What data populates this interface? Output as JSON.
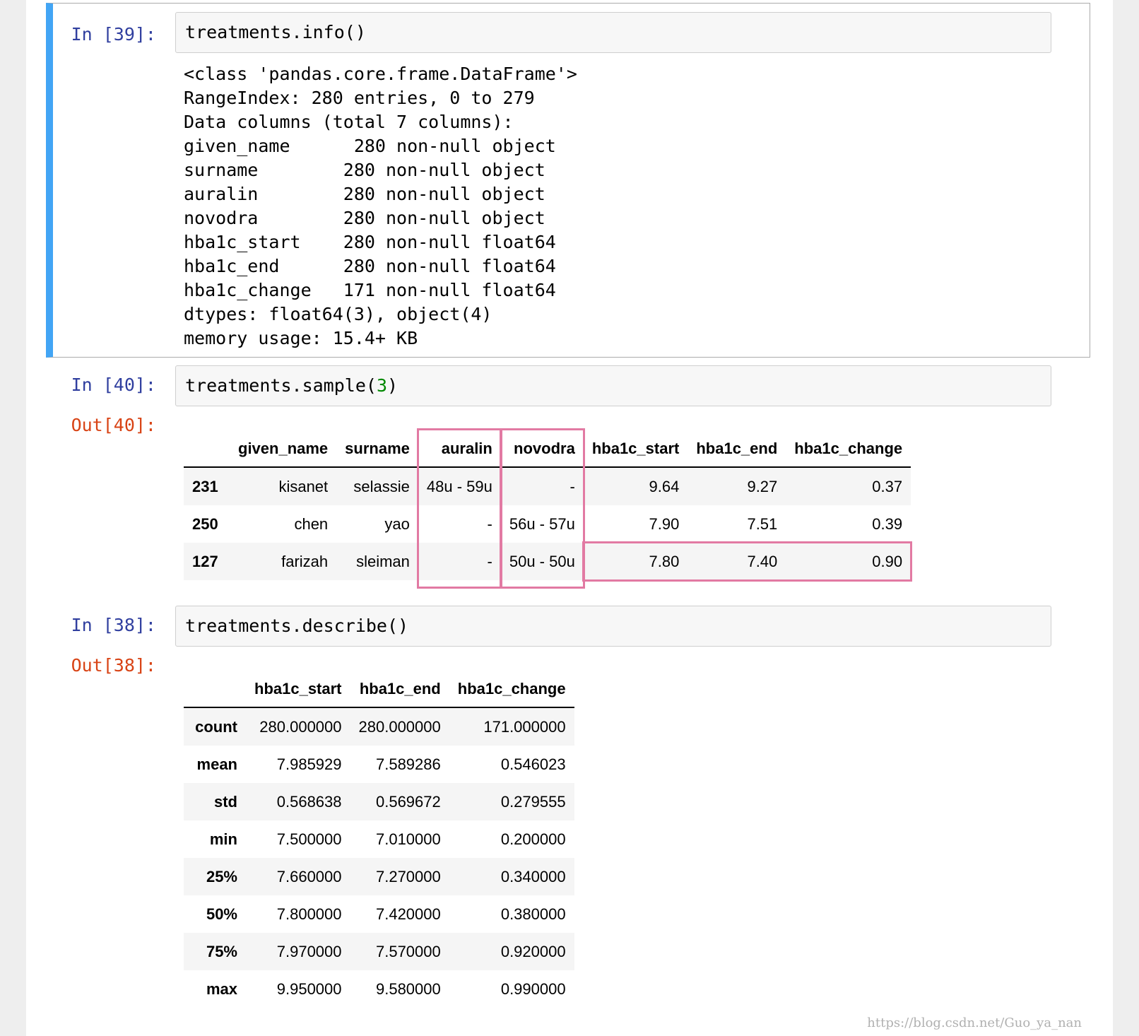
{
  "cells": {
    "info": {
      "prompt": "In [39]:",
      "code": "treatments.info()",
      "output_lines": [
        "<class 'pandas.core.frame.DataFrame'>",
        "RangeIndex: 280 entries, 0 to 279",
        "Data columns (total 7 columns):",
        "given_name      280 non-null object",
        "surname        280 non-null object",
        "auralin        280 non-null object",
        "novodra        280 non-null object",
        "hba1c_start    280 non-null float64",
        "hba1c_end      280 non-null float64",
        "hba1c_change   171 non-null float64",
        "dtypes: float64(3), object(4)",
        "memory usage: 15.4+ KB"
      ]
    },
    "sample": {
      "prompt": "In [40]:",
      "code_func": "treatments.sample",
      "code_open": "(",
      "code_arg": "3",
      "code_close": ")",
      "out_prompt": "Out[40]:",
      "columns": [
        "",
        "given_name",
        "surname",
        "auralin",
        "novodra",
        "hba1c_start",
        "hba1c_end",
        "hba1c_change"
      ],
      "rows": [
        {
          "index": "231",
          "cells": [
            "kisanet",
            "selassie",
            "48u - 59u",
            "-",
            "9.64",
            "9.27",
            "0.37"
          ]
        },
        {
          "index": "250",
          "cells": [
            "chen",
            "yao",
            "-",
            "56u - 57u",
            "7.90",
            "7.51",
            "0.39"
          ]
        },
        {
          "index": "127",
          "cells": [
            "farizah",
            "sleiman",
            "-",
            "50u - 50u",
            "7.80",
            "7.40",
            "0.90"
          ]
        }
      ],
      "highlight_color": "#e27aa3"
    },
    "describe": {
      "prompt": "In [38]:",
      "code": "treatments.describe()",
      "out_prompt": "Out[38]:",
      "columns": [
        "",
        "hba1c_start",
        "hba1c_end",
        "hba1c_change"
      ],
      "rows": [
        {
          "index": "count",
          "cells": [
            "280.000000",
            "280.000000",
            "171.000000"
          ]
        },
        {
          "index": "mean",
          "cells": [
            "7.985929",
            "7.589286",
            "0.546023"
          ]
        },
        {
          "index": "std",
          "cells": [
            "0.568638",
            "0.569672",
            "0.279555"
          ]
        },
        {
          "index": "min",
          "cells": [
            "7.500000",
            "7.010000",
            "0.200000"
          ]
        },
        {
          "index": "25%",
          "cells": [
            "7.660000",
            "7.270000",
            "0.340000"
          ]
        },
        {
          "index": "50%",
          "cells": [
            "7.800000",
            "7.420000",
            "0.380000"
          ]
        },
        {
          "index": "75%",
          "cells": [
            "7.970000",
            "7.570000",
            "0.920000"
          ]
        },
        {
          "index": "max",
          "cells": [
            "9.950000",
            "9.580000",
            "0.990000"
          ]
        }
      ]
    }
  },
  "watermark": "https://blog.csdn.net/Guo_ya_nan",
  "colors": {
    "selected_bar": "#42a5f5",
    "in_prompt": "#303f9f",
    "out_prompt": "#d84315",
    "number_literal": "#008800"
  }
}
